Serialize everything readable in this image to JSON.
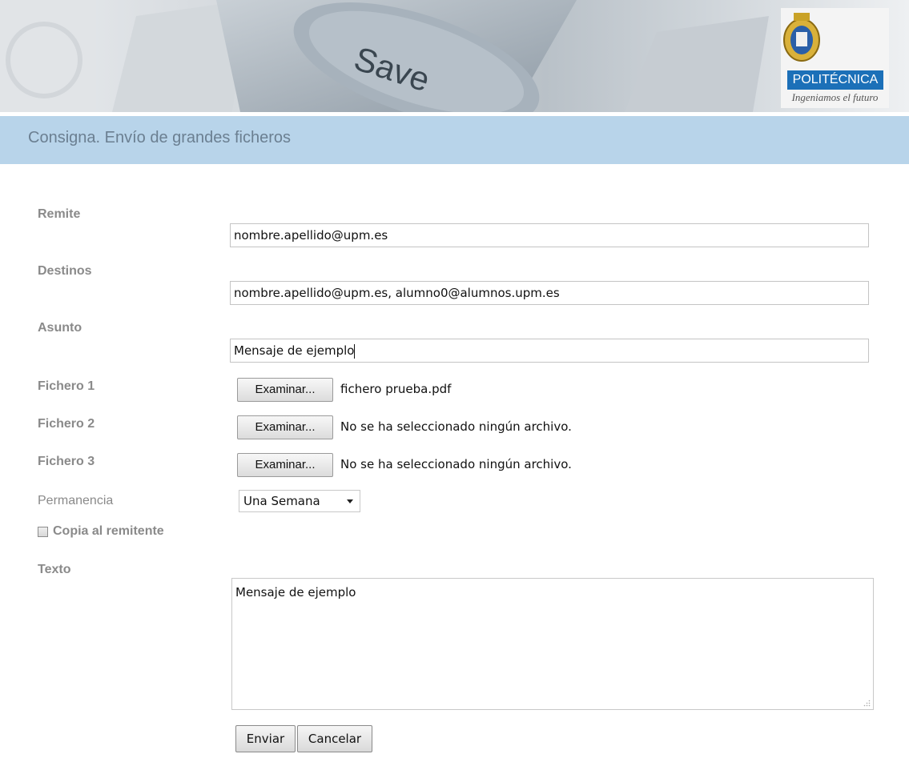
{
  "banner": {
    "key_text": "Save",
    "brand": "POLITÉCNICA",
    "motto": "Ingeniamos el futuro",
    "logo_icon": "university-seal-icon"
  },
  "page": {
    "title": "Consigna. Envío de grandes ficheros"
  },
  "form": {
    "remite": {
      "label": "Remite",
      "value": "nombre.apellido@upm.es"
    },
    "destinos": {
      "label": "Destinos",
      "value": "nombre.apellido@upm.es, alumno0@alumnos.upm.es"
    },
    "asunto": {
      "label": "Asunto",
      "value": "Mensaje de ejemplo"
    },
    "files": [
      {
        "label": "Fichero 1",
        "button": "Examinar...",
        "status": "fichero prueba.pdf"
      },
      {
        "label": "Fichero 2",
        "button": "Examinar...",
        "status": "No se ha seleccionado ningún archivo."
      },
      {
        "label": "Fichero 3",
        "button": "Examinar...",
        "status": "No se ha seleccionado ningún archivo."
      }
    ],
    "permanencia": {
      "label": "Permanencia",
      "selected": "Una Semana"
    },
    "copia": {
      "label": "Copia al remitente",
      "checked": false
    },
    "texto": {
      "label": "Texto",
      "value": "Mensaje de ejemplo"
    },
    "buttons": {
      "enviar": "Enviar",
      "cancelar": "Cancelar"
    }
  },
  "colors": {
    "title_bar": "#b8d4ea",
    "brand_blue": "#1c70b8",
    "label_gray": "#8a8a8a"
  }
}
